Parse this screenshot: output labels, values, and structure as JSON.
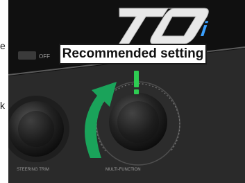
{
  "page": {
    "left_margin_chars": [
      "e",
      "k"
    ]
  },
  "product": {
    "logo_text": "TQ",
    "switch_label": "OFF",
    "left_knob_label": "STEERING TRIM",
    "right_knob_label": "MULTI-FUNCTION"
  },
  "callout": {
    "label": "Recommended setting"
  },
  "colors": {
    "arrow": "#1aa35a",
    "indicator": "#2ecc52",
    "callout_border": "#1a1a1a"
  },
  "icons": {
    "turn_arrow": "curved-arrow-icon",
    "indicator": "tick-mark-icon"
  }
}
